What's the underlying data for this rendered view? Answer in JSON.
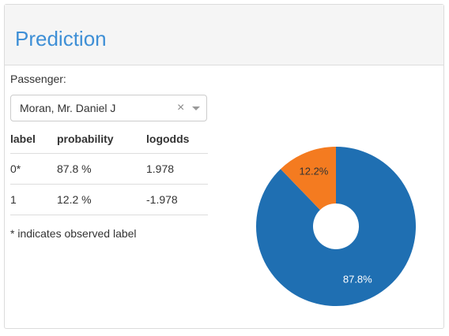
{
  "panel": {
    "title": "Prediction"
  },
  "selector": {
    "label": "Passenger:",
    "value": "Moran, Mr. Daniel J",
    "clear_icon": "×"
  },
  "table": {
    "headers": [
      "label",
      "probability",
      "logodds"
    ],
    "rows": [
      [
        "0*",
        "87.8 %",
        "1.978"
      ],
      [
        "1",
        "12.2 %",
        "-1.978"
      ]
    ]
  },
  "footnote": "* indicates observed label",
  "chart_data": {
    "type": "pie",
    "slices": [
      {
        "label": "0",
        "value": 87.8,
        "text": "87.8%",
        "color": "#1f6fb2",
        "label_color": "#ffffff"
      },
      {
        "label": "1",
        "value": 12.2,
        "text": "12.2%",
        "color": "#f47b20",
        "label_color": "#333333"
      }
    ]
  }
}
